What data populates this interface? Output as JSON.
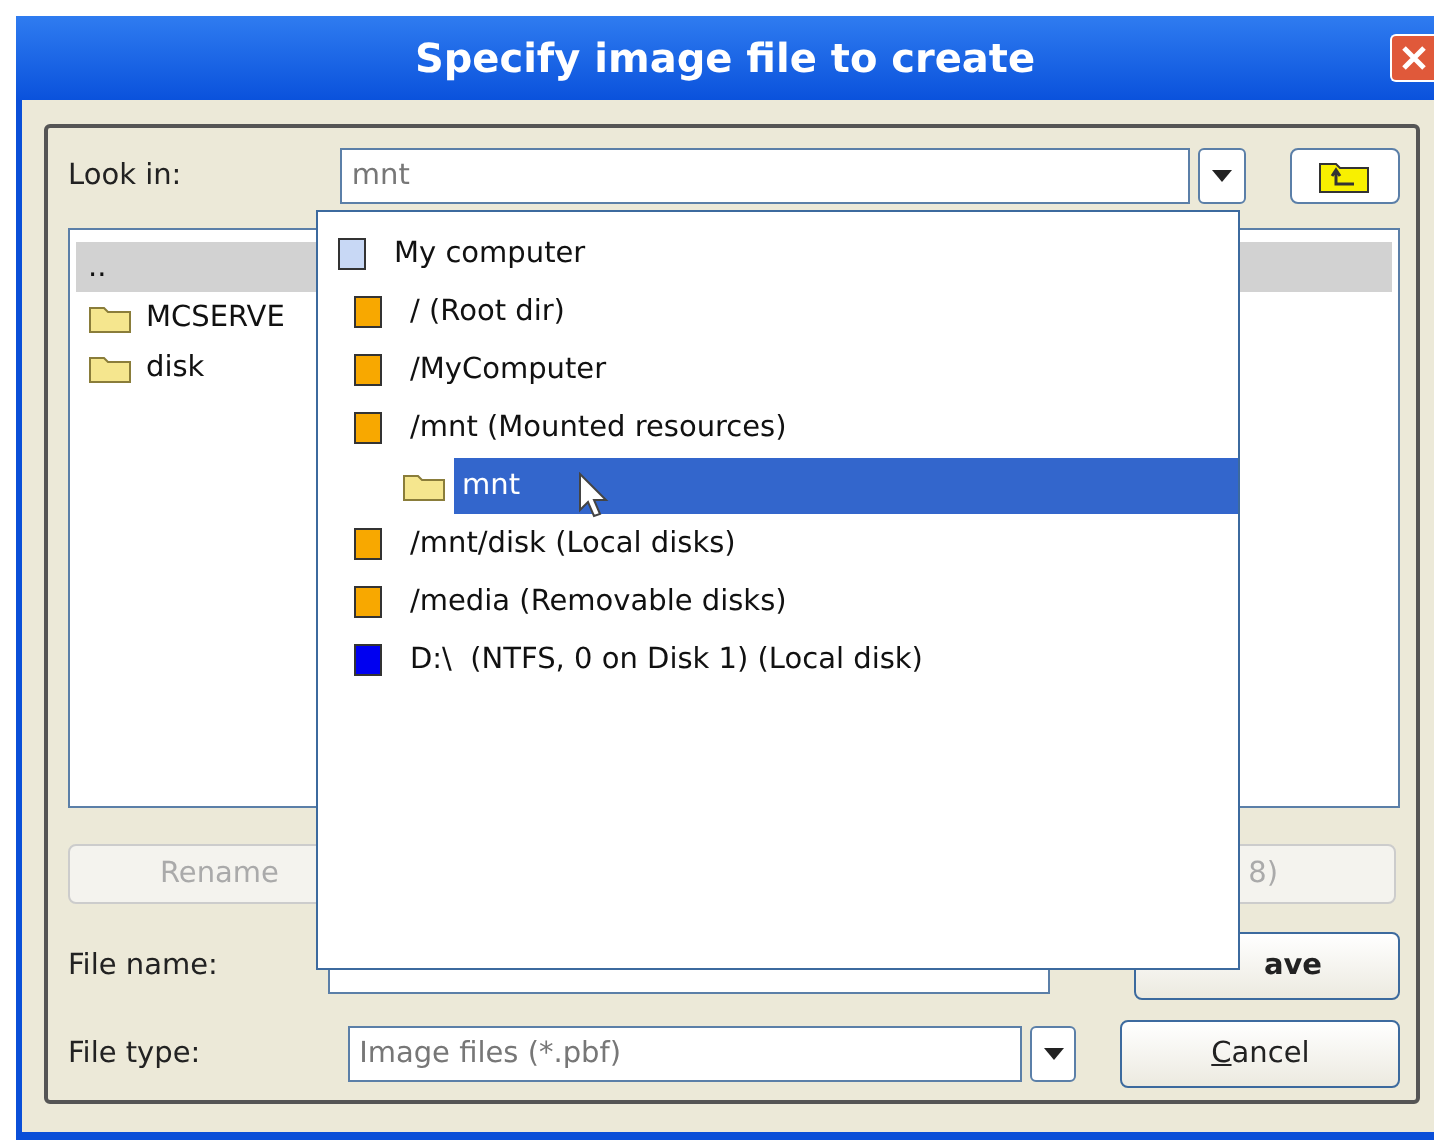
{
  "window": {
    "title": "Specify image file to create"
  },
  "look_in": {
    "label": "Look in:",
    "value": "mnt"
  },
  "files": [
    {
      "name": "..",
      "kind": "parent",
      "selected": true
    },
    {
      "name": "MCSERVE",
      "kind": "folder",
      "selected": false
    },
    {
      "name": "disk",
      "kind": "folder",
      "selected": false
    }
  ],
  "buttons_row": [
    {
      "label": "Rename",
      "disabled": true
    },
    {
      "label": "8)",
      "disabled": true
    }
  ],
  "file_name": {
    "label": "File name:"
  },
  "file_type": {
    "label": "File type:",
    "value": "Image files (*.pbf)"
  },
  "save_button": {
    "label": "ave"
  },
  "cancel_button": {
    "label": "Cancel"
  },
  "location_list": [
    {
      "name": "My computer",
      "kind": "computer",
      "selected": false,
      "children": [
        {
          "name": "/ (Root dir)",
          "kind": "mount",
          "selected": false
        },
        {
          "name": "/MyComputer",
          "kind": "mount",
          "selected": false
        },
        {
          "name": "/mnt (Mounted resources)",
          "kind": "mount",
          "selected": false,
          "children": [
            {
              "name": "mnt",
              "kind": "folder",
              "selected": true
            }
          ]
        },
        {
          "name": "/mnt/disk (Local disks)",
          "kind": "mount",
          "selected": false
        },
        {
          "name": "/media (Removable disks)",
          "kind": "mount",
          "selected": false
        },
        {
          "name": "D:\\  (NTFS, 0 on Disk 1) (Local disk)",
          "kind": "disk",
          "selected": false
        }
      ]
    }
  ]
}
